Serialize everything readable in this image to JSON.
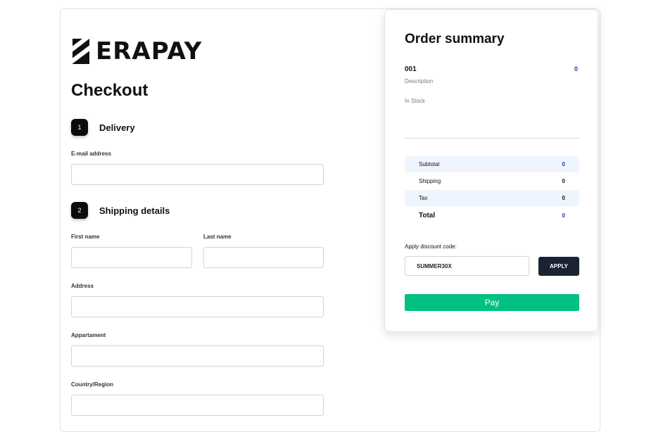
{
  "brand": {
    "name": "ERAPAY"
  },
  "checkout": {
    "title": "Checkout"
  },
  "steps": [
    {
      "number": "1",
      "label": "Delivery"
    },
    {
      "number": "2",
      "label": "Shipping details"
    }
  ],
  "fields": {
    "email": {
      "label": "E-mail address",
      "value": ""
    },
    "first_name": {
      "label": "First name",
      "value": ""
    },
    "last_name": {
      "label": "Last name",
      "value": ""
    },
    "address": {
      "label": "Address",
      "value": ""
    },
    "apartment": {
      "label": "Appartament",
      "value": ""
    },
    "country": {
      "label": "Country/Region",
      "value": ""
    }
  },
  "summary": {
    "title": "Order summary",
    "item": {
      "code": "001",
      "price": "0",
      "description": "Description",
      "stock": "In Stock"
    },
    "rows": {
      "subtotal": {
        "label": "Subtotal",
        "value": "0"
      },
      "shipping": {
        "label": "Shipping",
        "value": "0"
      },
      "tax": {
        "label": "Tax",
        "value": "0"
      },
      "total": {
        "label": "Total",
        "value": "0"
      }
    },
    "discount": {
      "label": "Apply discount code:",
      "value": "SUMMER30X",
      "apply_label": "APPLY"
    },
    "pay_label": "Pay"
  },
  "colors": {
    "accent_blue": "#2233cc",
    "pay_green": "#00c083",
    "apply_navy": "#1a2233",
    "row_shade": "#eef5fe"
  }
}
